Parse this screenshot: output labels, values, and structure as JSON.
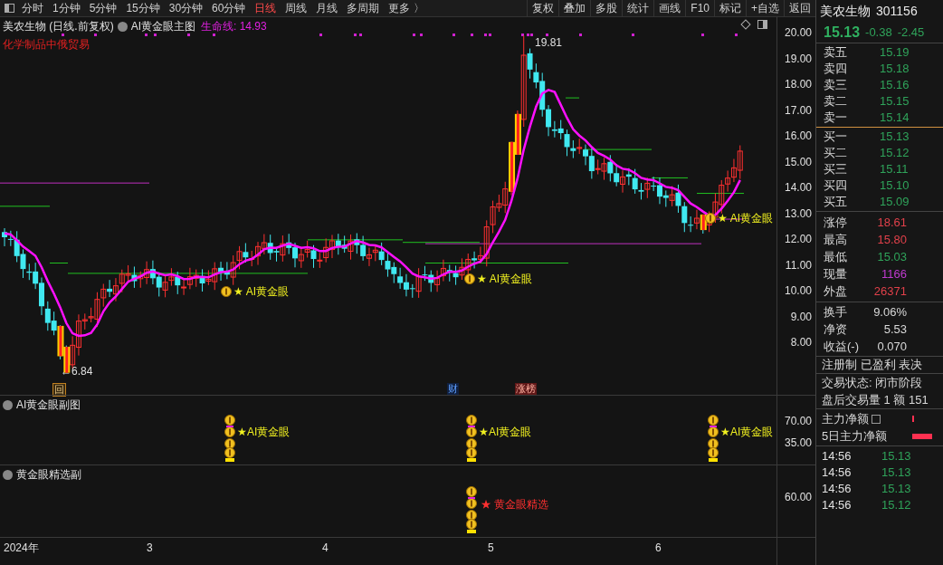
{
  "toolbar": {
    "periods": [
      {
        "label": "分时",
        "selected": false
      },
      {
        "label": "1分钟",
        "selected": false
      },
      {
        "label": "5分钟",
        "selected": false
      },
      {
        "label": "15分钟",
        "selected": false
      },
      {
        "label": "30分钟",
        "selected": false
      },
      {
        "label": "60分钟",
        "selected": false
      },
      {
        "label": "日线",
        "selected": true
      },
      {
        "label": "周线",
        "selected": false
      },
      {
        "label": "月线",
        "selected": false
      },
      {
        "label": "多周期",
        "selected": false
      },
      {
        "label": "更多 〉",
        "selected": false
      }
    ],
    "actions": [
      "复权",
      "叠加",
      "多股",
      "统计",
      "画线",
      "F10",
      "标记",
      "+自选",
      "返回"
    ]
  },
  "main_chart": {
    "title": "美农生物 (日线.前复权)",
    "indicator": "AI黄金眼主图",
    "lifeline": "生命线: 14.93",
    "concept": "化学制品中俄贸易",
    "high_label": "19.81",
    "low_label": "←6.84",
    "signals": [
      "★ AI黄金眼",
      "★ AI黄金眼",
      "★ AI黄金眼"
    ],
    "event_tags": [
      {
        "text": "回",
        "kind": "box"
      },
      {
        "text": "财",
        "kind": "finance"
      },
      {
        "text": "涨榜",
        "kind": "hot"
      }
    ],
    "y_ticks": [
      "20.00",
      "19.00",
      "18.00",
      "17.00",
      "16.00",
      "15.00",
      "14.00",
      "13.00",
      "12.00",
      "11.00",
      "10.00",
      "9.00",
      "8.00"
    ]
  },
  "sub_chart_1": {
    "title": "AI黄金眼副图",
    "y_ticks": [
      "70.00",
      "35.00"
    ],
    "signals": [
      "★AI黄金眼",
      "★AI黄金眼",
      "★AI黄金眼"
    ]
  },
  "sub_chart_2": {
    "title": "黄金眼精选副",
    "y_ticks": [
      "60.00"
    ],
    "signals": [
      "★ 黄金眼精选"
    ]
  },
  "date_axis": [
    "2024年",
    "3",
    "4",
    "5",
    "6"
  ],
  "quote_panel": {
    "name": "美农生物",
    "code": "301156",
    "price": "15.13",
    "change": "-0.38",
    "change_pct": "-2.45",
    "asks": [
      {
        "label": "卖五",
        "price": "15.19"
      },
      {
        "label": "卖四",
        "price": "15.18"
      },
      {
        "label": "卖三",
        "price": "15.16"
      },
      {
        "label": "卖二",
        "price": "15.15"
      },
      {
        "label": "卖一",
        "price": "15.14"
      }
    ],
    "bids": [
      {
        "label": "买一",
        "price": "15.13"
      },
      {
        "label": "买二",
        "price": "15.12"
      },
      {
        "label": "买三",
        "price": "15.11"
      },
      {
        "label": "买四",
        "price": "15.10"
      },
      {
        "label": "买五",
        "price": "15.09"
      }
    ],
    "stats": [
      {
        "label": "涨停",
        "value": "18.61",
        "color": "#e0404a"
      },
      {
        "label": "最高",
        "value": "15.80",
        "color": "#e0404a"
      },
      {
        "label": "最低",
        "value": "15.03",
        "color": "#2fa35a"
      },
      {
        "label": "现量",
        "value": "1166",
        "color": "#c03ad0"
      },
      {
        "label": "外盘",
        "value": "26371",
        "color": "#e0404a"
      }
    ],
    "ratios": [
      {
        "label": "换手",
        "value": "9.06%"
      },
      {
        "label": "净资",
        "value": "5.53"
      },
      {
        "label": "收益(-)",
        "value": "0.070"
      }
    ],
    "info": [
      "注册制 已盈利 表决",
      "交易状态: 闭市阶段",
      "盘后交易量 1 额 151"
    ],
    "fund_flow": [
      {
        "label": "主力净额"
      },
      {
        "label": "5日主力净额"
      }
    ],
    "ticks": [
      {
        "time": "14:56",
        "price": "15.13"
      },
      {
        "time": "14:56",
        "price": "15.13"
      },
      {
        "time": "14:56",
        "price": "15.13"
      },
      {
        "time": "14:56",
        "price": "15.12"
      }
    ]
  }
}
